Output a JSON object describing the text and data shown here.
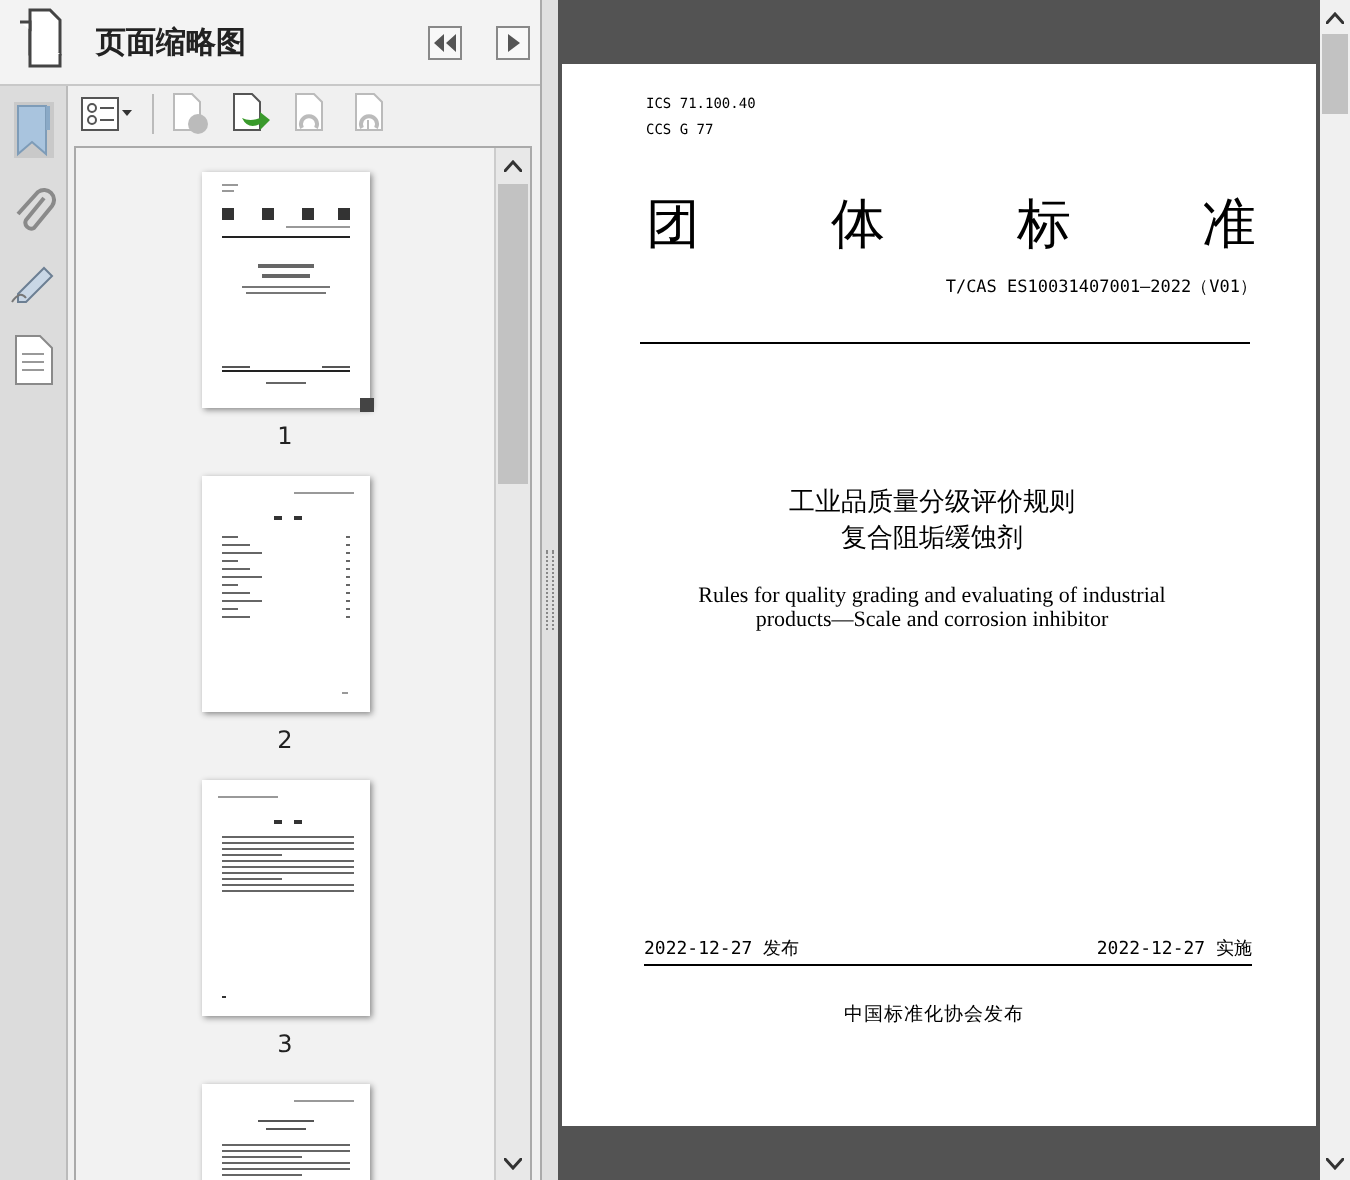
{
  "panel": {
    "title": "页面缩略图"
  },
  "toolbar": [
    {
      "kind": "options",
      "disabled": false
    },
    {
      "kind": "delete",
      "disabled": true
    },
    {
      "kind": "insert",
      "disabled": false
    },
    {
      "kind": "redo",
      "disabled": true
    },
    {
      "kind": "print",
      "disabled": true
    }
  ],
  "thumbnails": [
    {
      "label": "1",
      "kind": "cover",
      "current": true
    },
    {
      "label": "2",
      "kind": "contents",
      "current": false
    },
    {
      "label": "3",
      "kind": "text",
      "current": false
    },
    {
      "kind": "title-text"
    }
  ],
  "document": {
    "ics": "ICS 71.100.40",
    "ccs": "CCS G 77",
    "heading": [
      "团",
      "体",
      "标",
      "准"
    ],
    "code": "T/CAS ES10031407001—2022（V01）",
    "title_cn": [
      "工业品质量分级评价规则",
      "复合阻垢缓蚀剂"
    ],
    "title_en": "Rules for quality grading and evaluating of industrial products—Scale and corrosion inhibitor",
    "issued": "2022-12-27 发布",
    "effective": "2022-12-27 实施",
    "publisher": "中国标准化协会发布"
  }
}
